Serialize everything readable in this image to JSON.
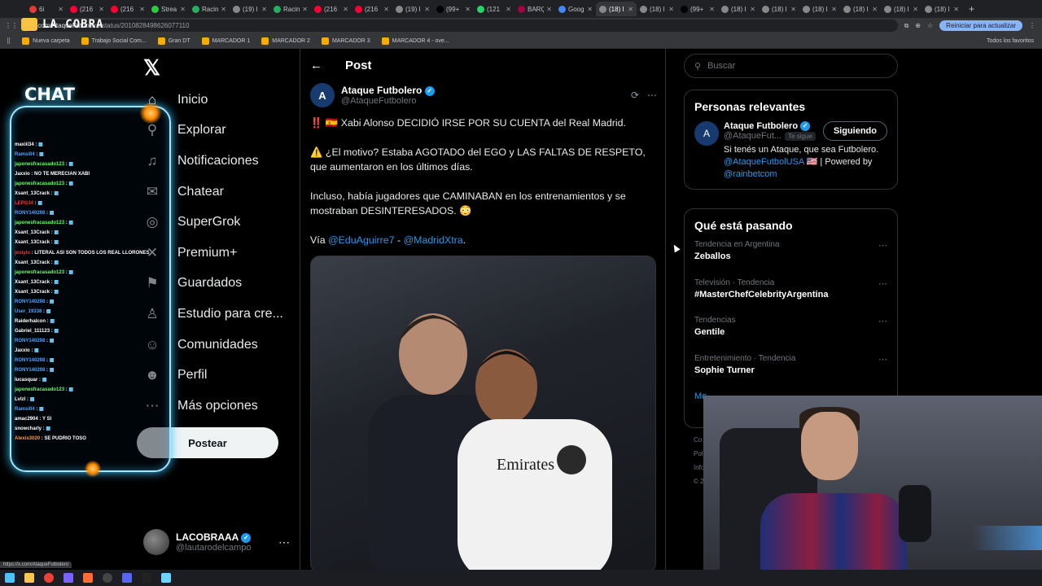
{
  "browser": {
    "tabs": [
      {
        "label": "6i",
        "color": "#e53935"
      },
      {
        "label": "(216",
        "color": "#ff0033"
      },
      {
        "label": "(216",
        "color": "#ff0033"
      },
      {
        "label": "Strea",
        "color": "#2ecc40"
      },
      {
        "label": "Racin",
        "color": "#27ae60"
      },
      {
        "label": "(19) I",
        "color": "#888888"
      },
      {
        "label": "Racin",
        "color": "#27ae60"
      },
      {
        "label": "(216",
        "color": "#ff0033"
      },
      {
        "label": "(216",
        "color": "#ff0033"
      },
      {
        "label": "(19) I",
        "color": "#888888"
      },
      {
        "label": "(99+",
        "color": "#000000"
      },
      {
        "label": "(121",
        "color": "#25d366"
      },
      {
        "label": "BARÇ",
        "color": "#a50044"
      },
      {
        "label": "Goog",
        "color": "#4285f4"
      },
      {
        "label": "(18) I",
        "color": "#888888",
        "active": true
      },
      {
        "label": "(18) I",
        "color": "#888888"
      },
      {
        "label": "(99+",
        "color": "#000000"
      },
      {
        "label": "(18) I",
        "color": "#888888"
      },
      {
        "label": "(18) I",
        "color": "#888888"
      },
      {
        "label": "(18) I",
        "color": "#888888"
      },
      {
        "label": "(18) I",
        "color": "#888888"
      },
      {
        "label": "(18) I",
        "color": "#888888"
      },
      {
        "label": "(18) I",
        "color": "#888888"
      }
    ],
    "url_prefix": "x.com/AtaqueFut",
    "url_rest": "bolero/status/2010828498626077110",
    "update_label": "Reiniciar para actualizar",
    "bookmarks": [
      "Nueva carpeta",
      "Trabajo Social Com...",
      "Gran DT",
      "MARCADOR 1",
      "MARCADOR 2",
      "MARCADOR 3",
      "MARCADOR 4 - ove..."
    ],
    "all_bookmarks": "Todos los favoritos",
    "status_url": "https://x.com/AtaqueFutbolero"
  },
  "overlay": {
    "brand": "LA COBRA",
    "chat_title": "CHAT",
    "chat": [
      {
        "user": "maxiii34",
        "msg": "",
        "color": "#ffffff"
      },
      {
        "user": "Ramsi04",
        "msg": "",
        "color": "#4aa3ff"
      },
      {
        "user": "japonesfracasado123",
        "msg": "",
        "color": "#66ff66"
      },
      {
        "user": "Jaxxio",
        "msg": "NO TE MERECIAN XABI",
        "color": "#ffffff"
      },
      {
        "user": "japonesfracasado123",
        "msg": "",
        "color": "#66ff66"
      },
      {
        "user": "Xsant_13Crack",
        "msg": "",
        "color": "#ffffff"
      },
      {
        "user": "LEPG34",
        "msg": "",
        "color": "#ff3333"
      },
      {
        "user": "RONY140298",
        "msg": "",
        "color": "#4aa3ff"
      },
      {
        "user": "japonesfracasado123",
        "msg": "",
        "color": "#66ff66"
      },
      {
        "user": "Xsant_13Crack",
        "msg": "",
        "color": "#ffffff"
      },
      {
        "user": "Xsant_13Crack",
        "msg": "",
        "color": "#ffffff"
      },
      {
        "user": "josiyiu",
        "msg": "LITERAL ASI SON TODOS LOS REAL LLORONES",
        "color": "#ff3333"
      },
      {
        "user": "Xsant_13Crack",
        "msg": "",
        "color": "#ffffff"
      },
      {
        "user": "japonesfracasado123",
        "msg": "",
        "color": "#66ff66"
      },
      {
        "user": "Xsant_13Crack",
        "msg": "",
        "color": "#ffffff"
      },
      {
        "user": "Xsant_13Crack",
        "msg": "",
        "color": "#ffffff"
      },
      {
        "user": "RONY140298",
        "msg": "",
        "color": "#4aa3ff"
      },
      {
        "user": "User_19338",
        "msg": "",
        "color": "#4aa3ff"
      },
      {
        "user": "Raiderhalcon",
        "msg": "",
        "color": "#ffffff"
      },
      {
        "user": "Gabriel_111123",
        "msg": "",
        "color": "#ffffff"
      },
      {
        "user": "RONY140298",
        "msg": "",
        "color": "#4aa3ff"
      },
      {
        "user": "Jaxxio",
        "msg": "",
        "color": "#ffffff"
      },
      {
        "user": "RONY140298",
        "msg": "",
        "color": "#4aa3ff"
      },
      {
        "user": "RONY140298",
        "msg": "",
        "color": "#4aa3ff"
      },
      {
        "user": "lucasquar",
        "msg": "",
        "color": "#ffffff"
      },
      {
        "user": "japonesfracasado123",
        "msg": "",
        "color": "#66ff66"
      },
      {
        "user": "Lvlzl",
        "msg": "",
        "color": "#ffffff"
      },
      {
        "user": "Ramsi04",
        "msg": "",
        "color": "#4aa3ff"
      },
      {
        "user": "amac2904",
        "msg": "Y SI",
        "color": "#ffffff"
      },
      {
        "user": "snowcharly",
        "msg": "",
        "color": "#ffffff"
      },
      {
        "user": "Alexis3020",
        "msg": "SE PUDRIO TOSO",
        "color": "#ff9933"
      }
    ]
  },
  "sidebar": {
    "items": [
      {
        "label": "Inicio",
        "icon": "home-icon",
        "glyph": "⌂"
      },
      {
        "label": "Explorar",
        "icon": "search-icon",
        "glyph": "⚲"
      },
      {
        "label": "Notificaciones",
        "icon": "bell-icon",
        "glyph": "♫"
      },
      {
        "label": "Chatear",
        "icon": "mail-icon",
        "glyph": "✉"
      },
      {
        "label": "SuperGrok",
        "icon": "grok-icon",
        "glyph": "◎"
      },
      {
        "label": "Premium+",
        "icon": "x-premium-icon",
        "glyph": "✕"
      },
      {
        "label": "Guardados",
        "icon": "bookmark-icon",
        "glyph": "⚑"
      },
      {
        "label": "Estudio para cre...",
        "icon": "studio-icon",
        "glyph": "♙"
      },
      {
        "label": "Comunidades",
        "icon": "communities-icon",
        "glyph": "☺"
      },
      {
        "label": "Perfil",
        "icon": "profile-icon",
        "glyph": "☻"
      },
      {
        "label": "Más opciones",
        "icon": "more-icon",
        "glyph": "⋯"
      }
    ],
    "post_label": "Postear",
    "account": {
      "name": "LACOBRAAA",
      "handle": "@lautarodelcampo"
    }
  },
  "main": {
    "header": "Post",
    "author": {
      "name": "Ataque Futbolero",
      "handle": "@AtaqueFutbolero"
    },
    "para1": "‼️ 🇪🇸 Xabi Alonso DECIDIÓ IRSE POR SU CUENTA del Real Madrid.",
    "para2": "⚠️ ¿El motivo? Estaba AGOTADO del EGO y LAS FALTAS DE RESPETO, que aumentaron en los últimos días.",
    "para3": "Incluso, había jugadores que CAMINABAN en los entrenamientos y se mostraban DESINTERESADOS. 😳",
    "via": "Vía",
    "link1": "@EduAguirre7",
    "dash": "-",
    "link2": "@MadridXtra",
    "dot": "."
  },
  "right": {
    "search_placeholder": "Buscar",
    "relevant_title": "Personas relevantes",
    "relevant": {
      "name": "Ataque Futbolero",
      "handle": "@AtaqueFut...",
      "follows_you": "Te sigue",
      "button": "Siguiendo",
      "bio1": "Si tenés un Ataque, que sea Futbolero.",
      "bio_link1": "@AtaqueFutbolUSA",
      "bio_mid": " 🇺🇸 | Powered by",
      "bio_link2": "@rainbetcom"
    },
    "trends_title": "Qué está pasando",
    "trends": [
      {
        "category": "Tendencia en Argentina",
        "name": "Zeballos"
      },
      {
        "category": "Televisión · Tendencia",
        "name": "#MasterChefCelebrityArgentina"
      },
      {
        "category": "Tendencias",
        "name": "Gentile"
      },
      {
        "category": "Entretenimiento · Tendencia",
        "name": "Sophie Turner"
      }
    ],
    "more": "Mo",
    "footer": [
      "Co",
      "Pol",
      "Info",
      "© 2"
    ]
  }
}
